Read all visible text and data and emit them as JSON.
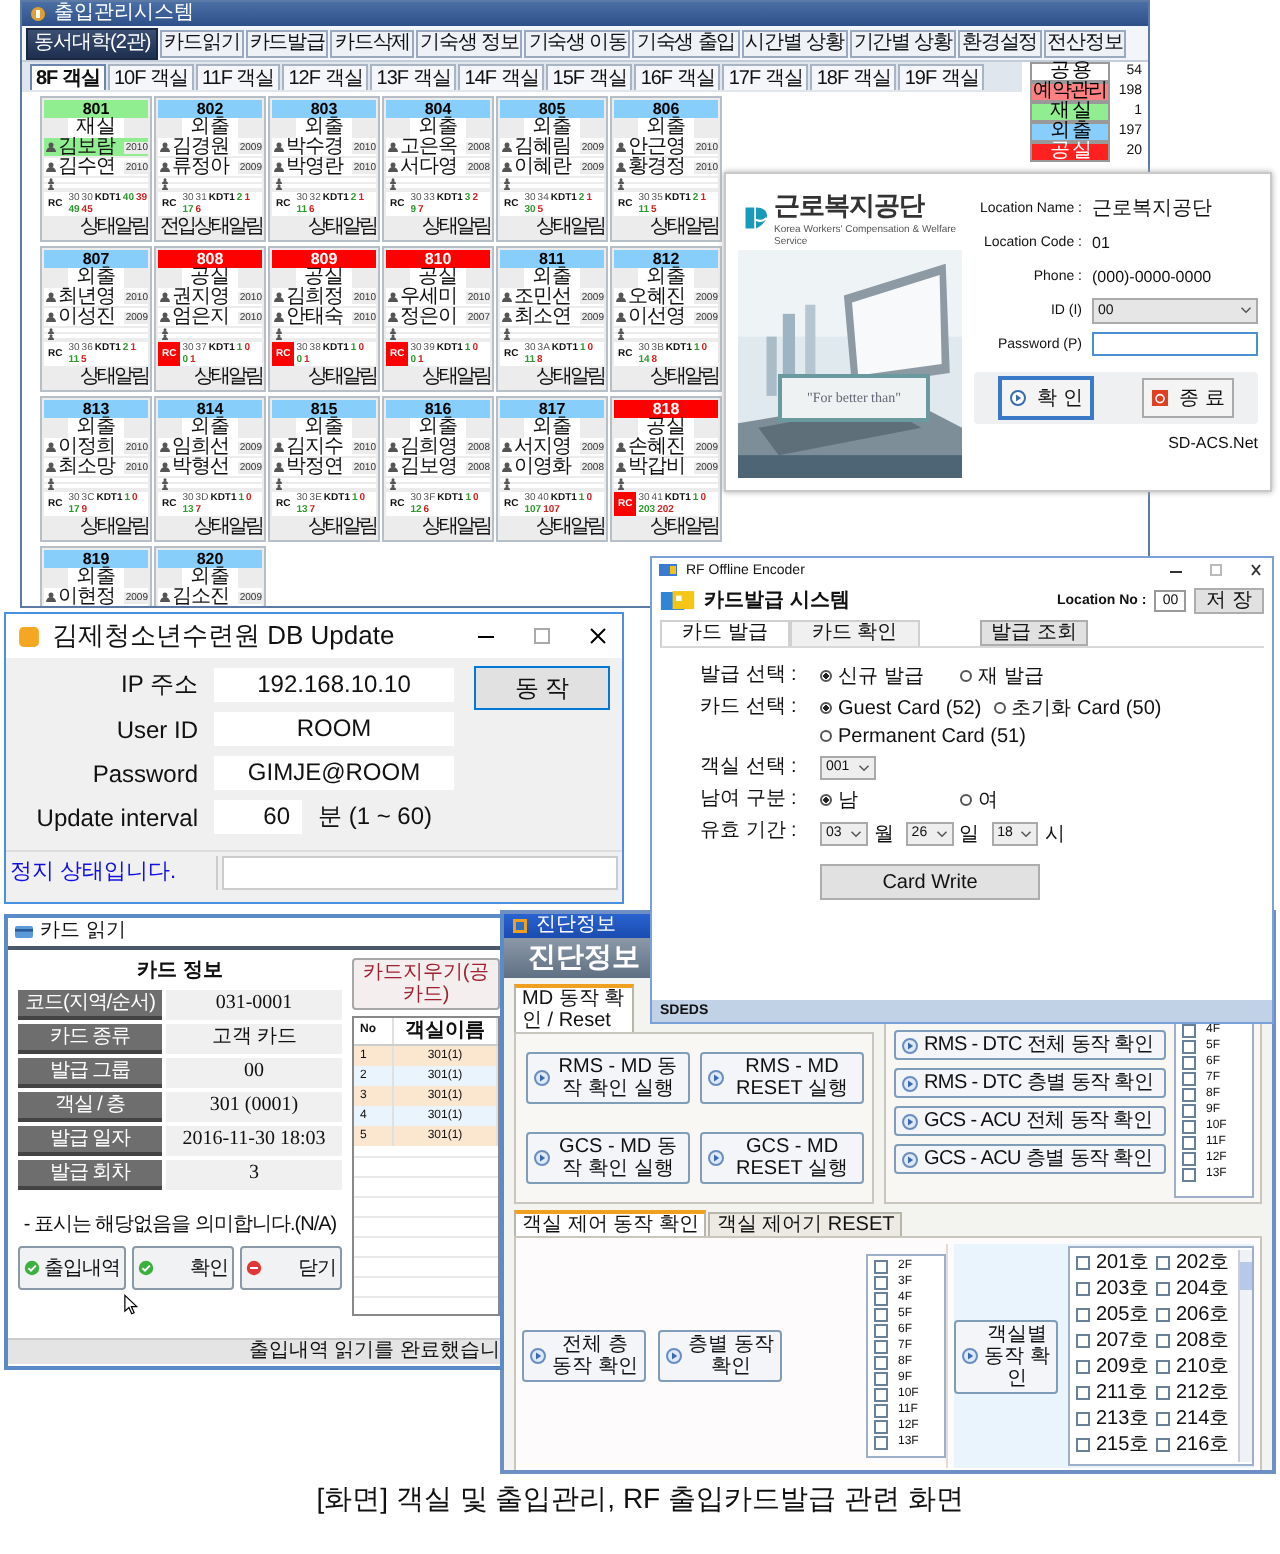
{
  "main_window": {
    "title": "출입관리시스템",
    "site": "동서대학(2관)",
    "toolbar": [
      "카드읽기",
      "카드발급",
      "카드삭제",
      "기숙생 정보",
      "기숙생 이동",
      "기숙생 출입",
      "시간별 상황",
      "기간별 상황",
      "환경설정",
      "전산정보"
    ],
    "floor_tabs": [
      {
        "label": "8F 객실",
        "selected": true
      },
      {
        "label": "10F 객실",
        "selected": false
      },
      {
        "label": "11F 객실",
        "selected": false
      },
      {
        "label": "12F 객실",
        "selected": false
      },
      {
        "label": "13F 객실",
        "selected": false
      },
      {
        "label": "14F 객실",
        "selected": false
      },
      {
        "label": "15F 객실",
        "selected": false
      },
      {
        "label": "16F 객실",
        "selected": false
      },
      {
        "label": "17F 객실",
        "selected": false
      },
      {
        "label": "18F 객실",
        "selected": false
      },
      {
        "label": "19F 객실",
        "selected": false
      }
    ],
    "rooms": [
      {
        "number": "801",
        "status": "재실",
        "color": "#90ee90",
        "occupants": [
          {
            "name": "김보람",
            "year": "2010",
            "present": true
          },
          {
            "name": "김수연",
            "year": "2010",
            "present": false
          }
        ],
        "rc_label": "RC",
        "rc_alert": false,
        "readings": [
          "30",
          "30"
        ],
        "kdt_label": "KDT1",
        "kdt": [
          "40",
          "39"
        ],
        "counts": [
          "49",
          "45"
        ],
        "footer": "상태알림"
      },
      {
        "number": "802",
        "status": "외출",
        "color": "#87cefa",
        "occupants": [
          {
            "name": "김경원",
            "year": "2009",
            "present": false
          },
          {
            "name": "류정아",
            "year": "2009",
            "present": false
          }
        ],
        "rc_label": "RC",
        "rc_alert": false,
        "readings": [
          "30",
          "31"
        ],
        "kdt_label": "KDT1",
        "kdt": [
          "2",
          "1"
        ],
        "counts": [
          "17",
          "6"
        ],
        "note": "전입",
        "footer": "상태알림"
      },
      {
        "number": "803",
        "status": "외출",
        "color": "#87cefa",
        "occupants": [
          {
            "name": "박수경",
            "year": "2010",
            "present": false
          },
          {
            "name": "박영란",
            "year": "2010",
            "present": false
          }
        ],
        "rc_label": "RC",
        "rc_alert": false,
        "readings": [
          "30",
          "32"
        ],
        "kdt_label": "KDT1",
        "kdt": [
          "2",
          "1"
        ],
        "counts": [
          "11",
          "6"
        ],
        "footer": "상태알림"
      },
      {
        "number": "804",
        "status": "외출",
        "color": "#87cefa",
        "occupants": [
          {
            "name": "고은옥",
            "year": "2008",
            "present": false
          },
          {
            "name": "서다영",
            "year": "2008",
            "present": false
          }
        ],
        "rc_label": "RC",
        "rc_alert": false,
        "readings": [
          "30",
          "33"
        ],
        "kdt_label": "KDT1",
        "kdt": [
          "3",
          "2"
        ],
        "counts": [
          "9",
          "7"
        ],
        "footer": "상태알림"
      },
      {
        "number": "805",
        "status": "외출",
        "color": "#87cefa",
        "occupants": [
          {
            "name": "김혜림",
            "year": "2009",
            "present": false
          },
          {
            "name": "이혜란",
            "year": "2009",
            "present": false
          }
        ],
        "rc_label": "RC",
        "rc_alert": false,
        "readings": [
          "30",
          "34"
        ],
        "kdt_label": "KDT1",
        "kdt": [
          "2",
          "1"
        ],
        "counts": [
          "30",
          "5"
        ],
        "footer": "상태알림"
      },
      {
        "number": "806",
        "status": "외출",
        "color": "#87cefa",
        "occupants": [
          {
            "name": "안근영",
            "year": "2010",
            "present": false
          },
          {
            "name": "황경정",
            "year": "2010",
            "present": false
          }
        ],
        "rc_label": "RC",
        "rc_alert": false,
        "readings": [
          "30",
          "35"
        ],
        "kdt_label": "KDT1",
        "kdt": [
          "2",
          "1"
        ],
        "counts": [
          "11",
          "5"
        ],
        "footer": "상태알림"
      },
      {
        "number": "807",
        "status": "외출",
        "color": "#87cefa",
        "occupants": [
          {
            "name": "최년영",
            "year": "2010",
            "present": false
          },
          {
            "name": "이성진",
            "year": "2009",
            "present": false
          }
        ],
        "rc_label": "RC",
        "rc_alert": false,
        "readings": [
          "30",
          "36"
        ],
        "kdt_label": "KDT1",
        "kdt": [
          "2",
          "1"
        ],
        "counts": [
          "11",
          "5"
        ],
        "footer": "상태알림"
      },
      {
        "number": "808",
        "status": "공실",
        "color": "#ff0000",
        "occupants": [
          {
            "name": "권지영",
            "year": "2010",
            "present": false
          },
          {
            "name": "엄은지",
            "year": "2010",
            "present": false
          }
        ],
        "rc_label": "RC",
        "rc_alert": true,
        "readings": [
          "30",
          "37"
        ],
        "kdt_label": "KDT1",
        "kdt": [
          "1",
          "0"
        ],
        "counts": [
          "0",
          "1"
        ],
        "footer": "상태알림"
      },
      {
        "number": "809",
        "status": "공실",
        "color": "#ff0000",
        "occupants": [
          {
            "name": "김희정",
            "year": "2010",
            "present": false
          },
          {
            "name": "안태숙",
            "year": "2010",
            "present": false
          }
        ],
        "rc_label": "RC",
        "rc_alert": true,
        "readings": [
          "30",
          "38"
        ],
        "kdt_label": "KDT1",
        "kdt": [
          "1",
          "0"
        ],
        "counts": [
          "0",
          "1"
        ],
        "footer": "상태알림"
      },
      {
        "number": "810",
        "status": "공실",
        "color": "#ff0000",
        "occupants": [
          {
            "name": "우세미",
            "year": "2010",
            "present": false
          },
          {
            "name": "정은이",
            "year": "2007",
            "present": false
          }
        ],
        "rc_label": "RC",
        "rc_alert": true,
        "readings": [
          "30",
          "39"
        ],
        "kdt_label": "KDT1",
        "kdt": [
          "1",
          "0"
        ],
        "counts": [
          "0",
          "1"
        ],
        "footer": "상태알림"
      },
      {
        "number": "811",
        "status": "외출",
        "color": "#87cefa",
        "occupants": [
          {
            "name": "조민선",
            "year": "2009",
            "present": false
          },
          {
            "name": "최소연",
            "year": "2009",
            "present": false
          }
        ],
        "rc_label": "RC",
        "rc_alert": false,
        "readings": [
          "30",
          "3A"
        ],
        "kdt_label": "KDT1",
        "kdt": [
          "1",
          "0"
        ],
        "counts": [
          "11",
          "8"
        ],
        "footer": "상태알림"
      },
      {
        "number": "812",
        "status": "외출",
        "color": "#87cefa",
        "occupants": [
          {
            "name": "오혜진",
            "year": "2009",
            "present": false
          },
          {
            "name": "이선영",
            "year": "2009",
            "present": false
          }
        ],
        "rc_label": "RC",
        "rc_alert": false,
        "readings": [
          "30",
          "3B"
        ],
        "kdt_label": "KDT1",
        "kdt": [
          "1",
          "0"
        ],
        "counts": [
          "14",
          "8"
        ],
        "footer": "상태알림"
      },
      {
        "number": "813",
        "status": "외출",
        "color": "#87cefa",
        "occupants": [
          {
            "name": "이정희",
            "year": "2010",
            "present": false
          },
          {
            "name": "최소망",
            "year": "2010",
            "present": false
          }
        ],
        "rc_label": "RC",
        "rc_alert": false,
        "readings": [
          "30",
          "3C"
        ],
        "kdt_label": "KDT1",
        "kdt": [
          "1",
          "0"
        ],
        "counts": [
          "17",
          "9"
        ],
        "footer": "상태알림"
      },
      {
        "number": "814",
        "status": "외출",
        "color": "#87cefa",
        "occupants": [
          {
            "name": "임희선",
            "year": "2009",
            "present": false
          },
          {
            "name": "박형선",
            "year": "2009",
            "present": false
          }
        ],
        "rc_label": "RC",
        "rc_alert": false,
        "readings": [
          "30",
          "3D"
        ],
        "kdt_label": "KDT1",
        "kdt": [
          "1",
          "0"
        ],
        "counts": [
          "13",
          "7"
        ],
        "footer": "상태알림"
      },
      {
        "number": "815",
        "status": "외출",
        "color": "#87cefa",
        "occupants": [
          {
            "name": "김지수",
            "year": "2010",
            "present": false
          },
          {
            "name": "박정연",
            "year": "2010",
            "present": false
          }
        ],
        "rc_label": "RC",
        "rc_alert": false,
        "readings": [
          "30",
          "3E"
        ],
        "kdt_label": "KDT1",
        "kdt": [
          "1",
          "0"
        ],
        "counts": [
          "13",
          "7"
        ],
        "footer": "상태알림"
      },
      {
        "number": "816",
        "status": "외출",
        "color": "#87cefa",
        "occupants": [
          {
            "name": "김희영",
            "year": "2008",
            "present": false
          },
          {
            "name": "김보영",
            "year": "2008",
            "present": false
          }
        ],
        "rc_label": "RC",
        "rc_alert": false,
        "readings": [
          "30",
          "3F"
        ],
        "kdt_label": "KDT1",
        "kdt": [
          "1",
          "0"
        ],
        "counts": [
          "12",
          "6"
        ],
        "footer": "상태알림"
      },
      {
        "number": "817",
        "status": "외출",
        "color": "#87cefa",
        "occupants": [
          {
            "name": "서지영",
            "year": "2009",
            "present": false
          },
          {
            "name": "이영화",
            "year": "2008",
            "present": false
          }
        ],
        "rc_label": "RC",
        "rc_alert": false,
        "readings": [
          "30",
          "40"
        ],
        "kdt_label": "KDT1",
        "kdt": [
          "1",
          "0"
        ],
        "counts": [
          "107",
          "107"
        ],
        "footer": "상태알림"
      },
      {
        "number": "818",
        "status": "공실",
        "color": "#ff0000",
        "occupants": [
          {
            "name": "손혜진",
            "year": "2009",
            "present": false
          },
          {
            "name": "박갑비",
            "year": "2009",
            "present": false
          }
        ],
        "rc_label": "RC",
        "rc_alert": true,
        "readings": [
          "30",
          "41"
        ],
        "kdt_label": "KDT1",
        "kdt": [
          "1",
          "0"
        ],
        "counts": [
          "203",
          "202"
        ],
        "footer": "상태알림"
      },
      {
        "number": "819",
        "status": "외출",
        "color": "#87cefa",
        "occupants": [
          {
            "name": "이현정",
            "year": "2009",
            "present": false
          }
        ]
      },
      {
        "number": "820",
        "status": "외출",
        "color": "#87cefa",
        "occupants": [
          {
            "name": "김소진",
            "year": "2009",
            "present": false
          }
        ]
      }
    ],
    "summary": [
      {
        "label": "공 용",
        "value": "54",
        "color": "#ffffff"
      },
      {
        "label": "예약관리",
        "value": "198",
        "color": "#ff8080"
      },
      {
        "label": "재 실",
        "value": "1",
        "color": "#90ee90"
      },
      {
        "label": "외 출",
        "value": "197",
        "color": "#87cefa"
      },
      {
        "label": "공 실",
        "value": "20",
        "color": "#ff2020"
      }
    ]
  },
  "login": {
    "logo": "근로복지공단",
    "logo_subtitle": "Korea Workers' Compensation & Welfare Service",
    "quote": "\"For better than\"",
    "fields": [
      {
        "label": "Location Name :",
        "value": "근로복지공단"
      },
      {
        "label": "Location Code :",
        "value": "01"
      },
      {
        "label": "Phone :",
        "value": "(000)-0000-0000"
      }
    ],
    "id": {
      "label": "ID (I)",
      "value": "00"
    },
    "password": {
      "label": "Password (P)"
    },
    "buttons": [
      {
        "label": "확 인",
        "kind": "ok"
      },
      {
        "label": "종 료",
        "kind": "exit"
      }
    ],
    "footer": "SD-ACS.Net"
  },
  "db_update": {
    "title": "김제청소년수련원 DB Update",
    "fields": [
      {
        "label": "IP 주소",
        "value": "192.168.10.10"
      },
      {
        "label": "User ID",
        "value": "ROOM"
      },
      {
        "label": "Password",
        "value": "GIMJE@ROOM"
      }
    ],
    "interval": {
      "label": "Update interval",
      "value": "60",
      "unit": "분 (1 ~ 60)"
    },
    "button": "동 작",
    "status": "정지 상태입니다."
  },
  "encoder": {
    "title": "RF Offline Encoder",
    "header": "카드발급 시스템",
    "location_label": "Location No :",
    "location_value": "00",
    "save": "저 장",
    "tabs": [
      {
        "label": "카드 발급",
        "selected": true
      },
      {
        "label": "카드 확인",
        "selected": false
      }
    ],
    "query": "발급 조회",
    "rows": [
      {
        "kind": "radio",
        "label": "발급 선택 :",
        "options": [
          {
            "label": "신규 발급",
            "selected": true
          },
          {
            "label": "재 발급",
            "selected": false
          }
        ]
      },
      {
        "kind": "radio",
        "label": "카드 선택 :",
        "options": [
          {
            "label": "Guest Card (52)",
            "selected": true
          },
          {
            "label": "초기화 Card (50)",
            "selected": false
          },
          {
            "label": "Permanent Card (51)",
            "selected": false
          }
        ]
      },
      {
        "kind": "select",
        "label": "객실 선택 :",
        "parts": [
          {
            "value": "001"
          }
        ]
      },
      {
        "kind": "radio",
        "label": "남여 구분 :",
        "options": [
          {
            "label": "남",
            "selected": true
          },
          {
            "label": "여",
            "selected": false
          }
        ]
      },
      {
        "kind": "select",
        "label": "유효 기간 :",
        "parts": [
          {
            "value": "03",
            "unit": "월"
          },
          {
            "value": "26",
            "unit": "일"
          },
          {
            "value": "18",
            "unit": "시"
          }
        ]
      }
    ],
    "write": "Card Write",
    "status": "SDEDS"
  },
  "card_read": {
    "title": "카드 읽기",
    "heading": "카드 정보",
    "erase": "카드지우기(공카드)",
    "rows": [
      {
        "label": "코드(지역/순서)",
        "value": "031-0001"
      },
      {
        "label": "카드 종류",
        "value": "고객 카드"
      },
      {
        "label": "발급 그룹",
        "value": "00"
      },
      {
        "label": "객실 / 층",
        "value": "301 (0001)"
      },
      {
        "label": "발급 일자",
        "value": "2016-11-30 18:03"
      },
      {
        "label": "발급 회차",
        "value": "3"
      }
    ],
    "note": "- 표시는 해당없음을 의미합니다.(N/A)",
    "buttons": [
      {
        "label": "출입내역",
        "kind": "ok"
      },
      {
        "label": "확인",
        "kind": "ok"
      },
      {
        "label": "닫기",
        "kind": "cancel"
      }
    ],
    "columns": [
      "No",
      "객실이름"
    ],
    "table": [
      [
        "1",
        "301(1)"
      ],
      [
        "2",
        "301(1)"
      ],
      [
        "3",
        "301(1)"
      ],
      [
        "4",
        "301(1)"
      ],
      [
        "5",
        "301(1)"
      ]
    ],
    "status": "출입내역 읽기를 완료했습니"
  },
  "diagnostics": {
    "title": "진단정보",
    "header": "진단정보",
    "md_tabs": [
      {
        "label": "MD 동작 확인 / Reset",
        "selected": true
      }
    ],
    "md_buttons": [
      "RMS - MD 동작 확인 실행",
      "RMS - MD RESET 실행",
      "GCS - MD 동작 확인 실행",
      "GCS - MD RESET 실행"
    ],
    "floor_buttons": [
      "RMS - DTC 전체 동작 확인",
      "RMS - DTC 층별 동작 확인",
      "GCS - ACU 전체 동작 확인",
      "GCS - ACU 층별 동작 확인"
    ],
    "floor_list": [
      {
        "label": "4F",
        "checked": false
      },
      {
        "label": "5F",
        "checked": false
      },
      {
        "label": "6F",
        "checked": false
      },
      {
        "label": "7F",
        "checked": false
      },
      {
        "label": "8F",
        "checked": false
      },
      {
        "label": "9F",
        "checked": false
      },
      {
        "label": "10F",
        "checked": false
      },
      {
        "label": "11F",
        "checked": false
      },
      {
        "label": "12F",
        "checked": false
      },
      {
        "label": "13F",
        "checked": false
      }
    ],
    "room_tabs": [
      {
        "label": "객실 제어 동작 확인",
        "selected": true
      },
      {
        "label": "객실 제어기 RESET",
        "selected": false
      }
    ],
    "room_floor_buttons": [
      "전체 층 동작 확인",
      "층별 동작 확인"
    ],
    "room_floor_list": [
      {
        "label": "2F",
        "checked": false
      },
      {
        "label": "3F",
        "checked": false
      },
      {
        "label": "4F",
        "checked": false
      },
      {
        "label": "5F",
        "checked": false
      },
      {
        "label": "6F",
        "checked": false
      },
      {
        "label": "7F",
        "checked": false
      },
      {
        "label": "8F",
        "checked": false
      },
      {
        "label": "9F",
        "checked": false
      },
      {
        "label": "10F",
        "checked": false
      },
      {
        "label": "11F",
        "checked": false
      },
      {
        "label": "12F",
        "checked": false
      },
      {
        "label": "13F",
        "checked": false
      }
    ],
    "room_button": "객실별 동작 확인",
    "room_list": [
      {
        "label": "201호",
        "checked": false
      },
      {
        "label": "202호",
        "checked": false
      },
      {
        "label": "203호",
        "checked": false
      },
      {
        "label": "204호",
        "checked": false
      },
      {
        "label": "205호",
        "checked": false
      },
      {
        "label": "206호",
        "checked": false
      },
      {
        "label": "207호",
        "checked": false
      },
      {
        "label": "208호",
        "checked": false
      },
      {
        "label": "209호",
        "checked": false
      },
      {
        "label": "210호",
        "checked": false
      },
      {
        "label": "211호",
        "checked": false
      },
      {
        "label": "212호",
        "checked": false
      },
      {
        "label": "213호",
        "checked": false
      },
      {
        "label": "214호",
        "checked": false
      },
      {
        "label": "215호",
        "checked": false
      },
      {
        "label": "216호",
        "checked": false
      }
    ]
  },
  "caption": "[화면] 객실 및 출입관리, RF 출입카드발급 관련 화면"
}
